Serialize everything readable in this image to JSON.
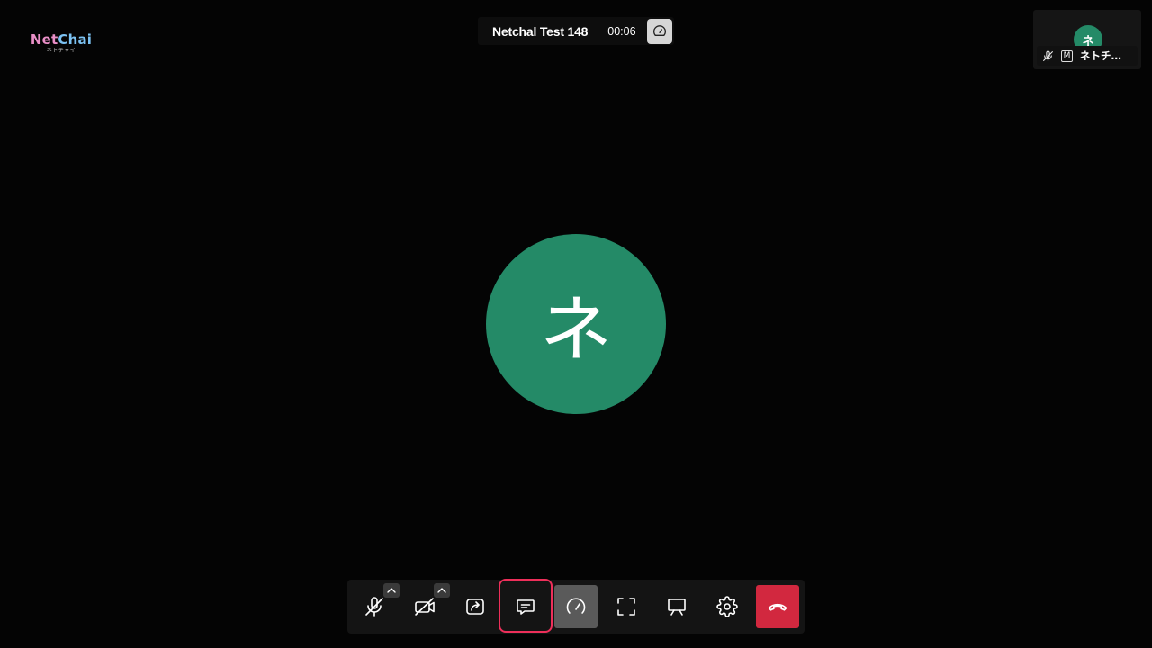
{
  "logo": {
    "name_part1": "Net",
    "name_part2": "Chai",
    "subtitle": "ネトチャイ"
  },
  "meeting": {
    "title": "Netchal Test 148",
    "elapsed": "00:06"
  },
  "self_view": {
    "initial": "ネ",
    "name": "ネトチ…",
    "badge": "M"
  },
  "participant": {
    "initial": "ネ"
  },
  "toolbar": {
    "buttons": [
      {
        "name": "mic-toggle-button",
        "icon": "mic-off-icon"
      },
      {
        "name": "camera-toggle-button",
        "icon": "camera-off-icon"
      },
      {
        "name": "share-screen-button",
        "icon": "share-icon"
      },
      {
        "name": "chat-button",
        "icon": "chat-icon",
        "highlighted": true
      },
      {
        "name": "performance-stats-button",
        "icon": "speedometer-icon",
        "active": true
      },
      {
        "name": "fullscreen-button",
        "icon": "fullscreen-icon"
      },
      {
        "name": "whiteboard-button",
        "icon": "presentation-icon"
      },
      {
        "name": "settings-button",
        "icon": "gear-icon"
      },
      {
        "name": "leave-call-button",
        "icon": "hang-up-icon"
      }
    ]
  },
  "colors": {
    "background": "#040404",
    "avatar": "#248a67",
    "hangup": "#d2283f",
    "highlight": "#ee2f5a",
    "logo_pink": "#e98fc7",
    "logo_blue": "#7cc2f2"
  }
}
